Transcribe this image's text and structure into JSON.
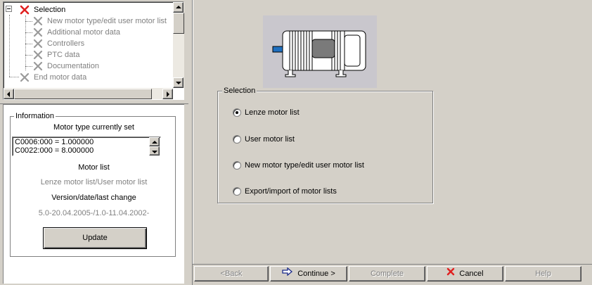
{
  "tree": {
    "items": [
      {
        "label": "Selection",
        "state": "active"
      },
      {
        "label": "New motor type/edit user motor list",
        "state": "disabled"
      },
      {
        "label": "Additional motor data",
        "state": "disabled"
      },
      {
        "label": "Controllers",
        "state": "disabled"
      },
      {
        "label": "PTC data",
        "state": "disabled"
      },
      {
        "label": "Documentation",
        "state": "disabled"
      },
      {
        "label": "End motor data",
        "state": "disabled"
      }
    ]
  },
  "info": {
    "group_title": "Information",
    "motor_type_label": "Motor type currently set",
    "motor_type_lines": [
      "C0006:000 = 1.000000",
      "C0022:000 = 8.000000"
    ],
    "motor_list_label": "Motor list",
    "motor_list_value": "Lenze motor list/User motor list",
    "version_label": "Version/date/last change",
    "version_value": "5.0-20.04.2005-/1.0-11.04.2002-",
    "update_button": "Update"
  },
  "selection": {
    "group_title": "Selection",
    "options": [
      {
        "label": "Lenze motor list",
        "checked": true
      },
      {
        "label": "User motor list",
        "checked": false
      },
      {
        "label": "New motor type/edit user motor list",
        "checked": false
      },
      {
        "label": "Export/import of motor lists",
        "checked": false
      }
    ]
  },
  "buttons": {
    "back": "<Back",
    "continue": "Continue >",
    "complete": "Complete",
    "cancel": "Cancel",
    "help": "Help"
  },
  "icons": {
    "active_x": "red-x-icon",
    "disabled_x": "gray-x-icon",
    "continue": "arrow-right-icon",
    "cancel": "red-x-icon"
  },
  "colors": {
    "active_x": "#e02020",
    "disabled_x": "#9a9a9a",
    "motor_connector": "#1e6fc0"
  }
}
